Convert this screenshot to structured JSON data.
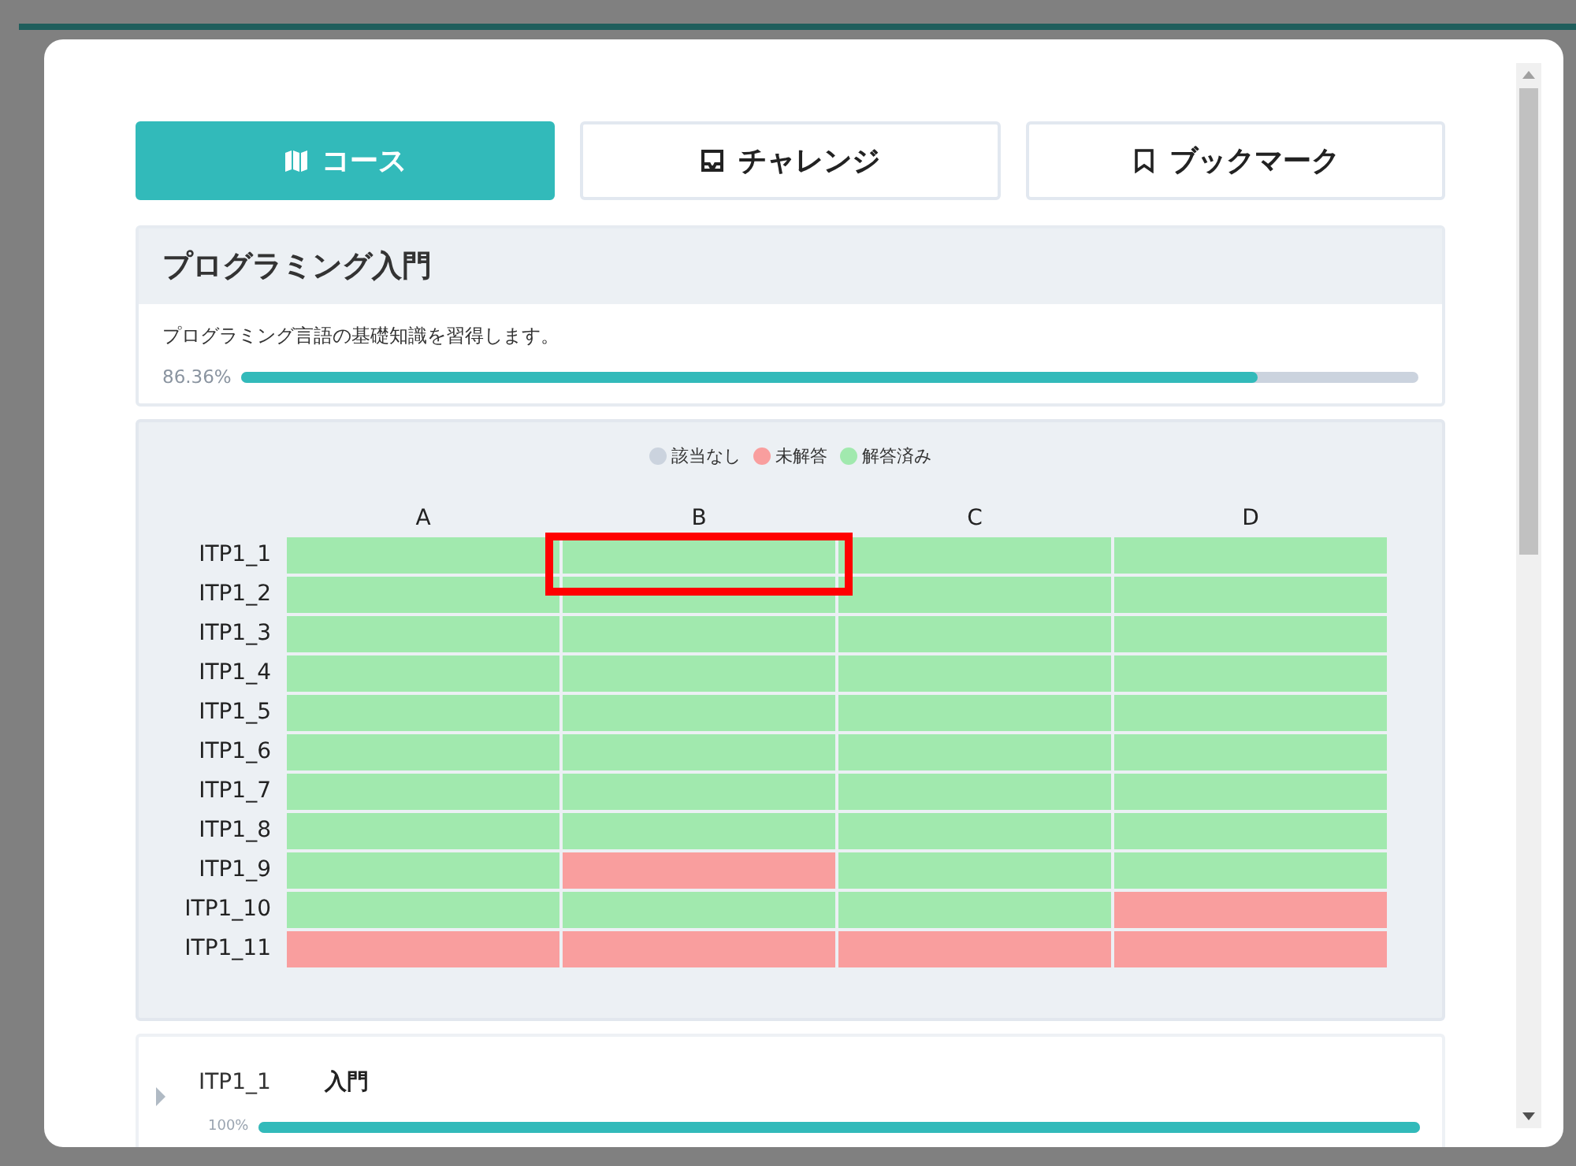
{
  "tabs": [
    {
      "label": "コース",
      "selected": true
    },
    {
      "label": "チャレンジ",
      "selected": false
    },
    {
      "label": "ブックマーク",
      "selected": false
    }
  ],
  "course": {
    "title": "プログラミング入門",
    "description": "プログラミング言語の基礎知識を習得します。",
    "progress_text": "86.36%",
    "level": 0.8636
  },
  "legend": [
    {
      "label": "該当なし",
      "kind": "none",
      "color": "#cbd3de"
    },
    {
      "label": "未解答",
      "kind": "unanswered",
      "color": "#f99e9e"
    },
    {
      "label": "解答済み",
      "kind": "answered",
      "color": "#a1e9ae"
    }
  ],
  "grid": {
    "columns": [
      "A",
      "B",
      "C",
      "D"
    ],
    "rows": [
      {
        "label": "ITP1_1",
        "cells": [
          {
            "kind": "answered"
          },
          {
            "kind": "answered"
          },
          {
            "kind": "answered"
          },
          {
            "kind": "answered"
          }
        ]
      },
      {
        "label": "ITP1_2",
        "cells": [
          {
            "kind": "answered"
          },
          {
            "kind": "answered"
          },
          {
            "kind": "answered"
          },
          {
            "kind": "answered"
          }
        ]
      },
      {
        "label": "ITP1_3",
        "cells": [
          {
            "kind": "answered"
          },
          {
            "kind": "answered"
          },
          {
            "kind": "answered"
          },
          {
            "kind": "answered"
          }
        ]
      },
      {
        "label": "ITP1_4",
        "cells": [
          {
            "kind": "answered"
          },
          {
            "kind": "answered"
          },
          {
            "kind": "answered"
          },
          {
            "kind": "answered"
          }
        ]
      },
      {
        "label": "ITP1_5",
        "cells": [
          {
            "kind": "answered"
          },
          {
            "kind": "answered"
          },
          {
            "kind": "answered"
          },
          {
            "kind": "answered"
          }
        ]
      },
      {
        "label": "ITP1_6",
        "cells": [
          {
            "kind": "answered"
          },
          {
            "kind": "answered"
          },
          {
            "kind": "answered"
          },
          {
            "kind": "answered"
          }
        ]
      },
      {
        "label": "ITP1_7",
        "cells": [
          {
            "kind": "answered"
          },
          {
            "kind": "answered"
          },
          {
            "kind": "answered"
          },
          {
            "kind": "answered"
          }
        ]
      },
      {
        "label": "ITP1_8",
        "cells": [
          {
            "kind": "answered"
          },
          {
            "kind": "answered"
          },
          {
            "kind": "answered"
          },
          {
            "kind": "answered"
          }
        ]
      },
      {
        "label": "ITP1_9",
        "cells": [
          {
            "kind": "answered"
          },
          {
            "kind": "unanswered"
          },
          {
            "kind": "answered"
          },
          {
            "kind": "answered"
          }
        ]
      },
      {
        "label": "ITP1_10",
        "cells": [
          {
            "kind": "answered"
          },
          {
            "kind": "answered"
          },
          {
            "kind": "answered"
          },
          {
            "kind": "unanswered"
          }
        ]
      },
      {
        "label": "ITP1_11",
        "cells": [
          {
            "kind": "unanswered"
          },
          {
            "kind": "unanswered"
          },
          {
            "kind": "unanswered"
          },
          {
            "kind": "unanswered"
          }
        ]
      }
    ]
  },
  "lessons": [
    {
      "id": "ITP1_1",
      "title": "入門",
      "progress_text": "100%",
      "level": 1,
      "expanded": false
    }
  ]
}
